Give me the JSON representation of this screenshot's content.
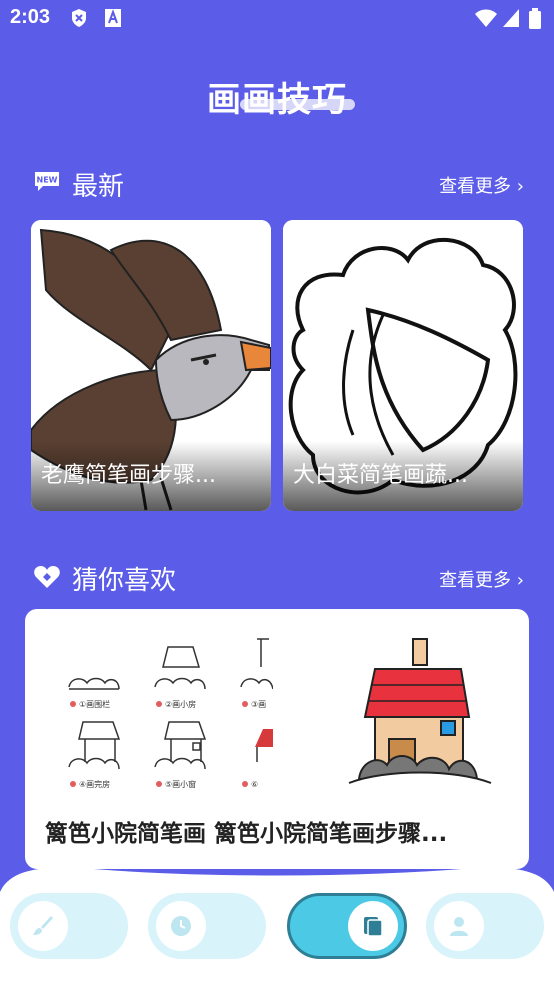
{
  "status": {
    "time": "2:03"
  },
  "header": {
    "title": "画画技巧"
  },
  "latest": {
    "badge": "NEW",
    "label": "最新",
    "more": "查看更多",
    "cards": [
      {
        "caption": "老鹰简笔画步骤..."
      },
      {
        "caption": "大白菜简笔画蔬..."
      }
    ]
  },
  "guess": {
    "label": "猜你喜欢",
    "more": "查看更多",
    "card": {
      "title": "篱笆小院简笔画 篱笆小院简笔画步骤...",
      "steps": [
        "①画围栏",
        "②画小房",
        "③画",
        "④画完房",
        "⑤画小窗",
        "⑥"
      ]
    }
  },
  "nav": {
    "items": [
      "brush-icon",
      "clock-icon",
      "book-icon",
      "user-icon"
    ],
    "active_index": 2
  },
  "colors": {
    "background": "#5B5CE8",
    "nav_pill": "#D8F4FA",
    "nav_active": "#4CC9E4"
  }
}
